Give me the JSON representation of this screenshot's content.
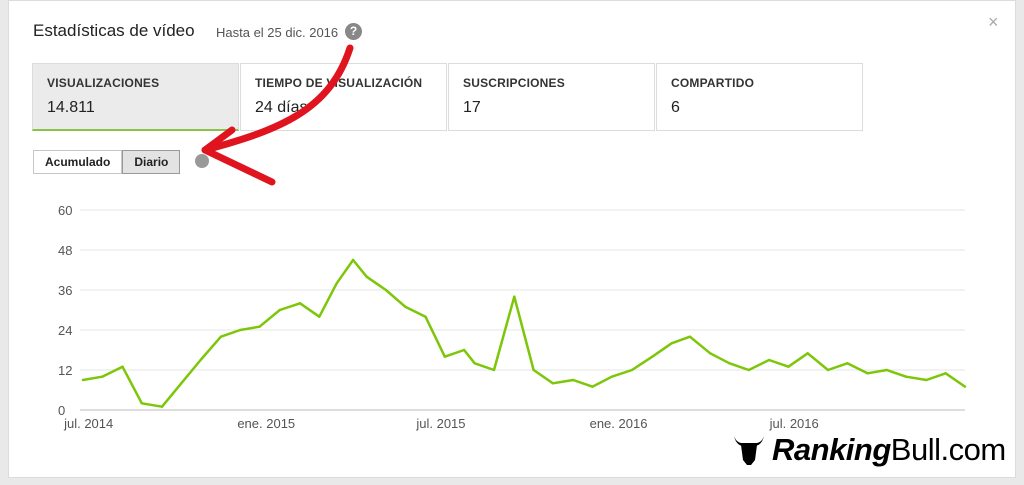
{
  "dialog": {
    "title": "Estadísticas de vídeo",
    "subtitle": "Hasta el 25 dic. 2016",
    "help_glyph": "?",
    "close_glyph": "×"
  },
  "metrics": [
    {
      "label": "VISUALIZACIONES",
      "value": "14.811"
    },
    {
      "label": "TIEMPO DE VISUALIZACIÓN",
      "value": "24 días"
    },
    {
      "label": "SUSCRIPCIONES",
      "value": "17"
    },
    {
      "label": "COMPARTIDO",
      "value": "6"
    }
  ],
  "toggle": {
    "accumulated": "Acumulado",
    "daily": "Diario"
  },
  "colors": {
    "line": "#7dc60a",
    "arrow": "#e0141e",
    "accent": "#8bc34a"
  },
  "chart_data": {
    "type": "line",
    "title": "",
    "ylim": [
      0,
      60
    ],
    "y_ticks": [
      "0",
      "12",
      "24",
      "36",
      "48",
      "60"
    ],
    "x_ticks": [
      "jul. 2014",
      "ene. 2015",
      "jul. 2015",
      "ene. 2016",
      "jul. 2016"
    ],
    "x_tick_dates": [
      "2014-07-01",
      "2015-01-01",
      "2015-07-01",
      "2016-01-01",
      "2016-07-01"
    ],
    "grid": true,
    "series": [
      {
        "x": [
          "2014-06-25",
          "2014-07-15",
          "2014-08-05",
          "2014-08-25",
          "2014-09-15",
          "2014-10-05",
          "2014-10-25",
          "2014-11-15",
          "2014-12-05",
          "2014-12-25",
          "2015-01-15",
          "2015-02-05",
          "2015-02-25",
          "2015-03-15",
          "2015-04-01",
          "2015-04-15",
          "2015-05-05",
          "2015-05-25",
          "2015-06-15",
          "2015-07-05",
          "2015-07-25",
          "2015-08-05",
          "2015-08-25",
          "2015-09-15",
          "2015-10-05",
          "2015-10-25",
          "2015-11-15",
          "2015-12-05",
          "2015-12-25",
          "2016-01-15",
          "2016-02-05",
          "2016-02-25",
          "2016-03-15",
          "2016-04-05",
          "2016-04-25",
          "2016-05-15",
          "2016-06-05",
          "2016-06-25",
          "2016-07-15",
          "2016-08-05",
          "2016-08-25",
          "2016-09-15",
          "2016-10-05",
          "2016-10-25",
          "2016-11-15",
          "2016-12-05",
          "2016-12-25"
        ],
        "values": [
          9,
          10,
          13,
          2,
          1,
          8,
          15,
          22,
          24,
          25,
          30,
          32,
          28,
          38,
          45,
          40,
          36,
          31,
          28,
          16,
          18,
          14,
          12,
          34,
          12,
          8,
          9,
          7,
          10,
          12,
          16,
          20,
          22,
          17,
          14,
          12,
          15,
          13,
          17,
          12,
          14,
          11,
          12,
          10,
          9,
          11,
          7
        ]
      }
    ]
  }
}
